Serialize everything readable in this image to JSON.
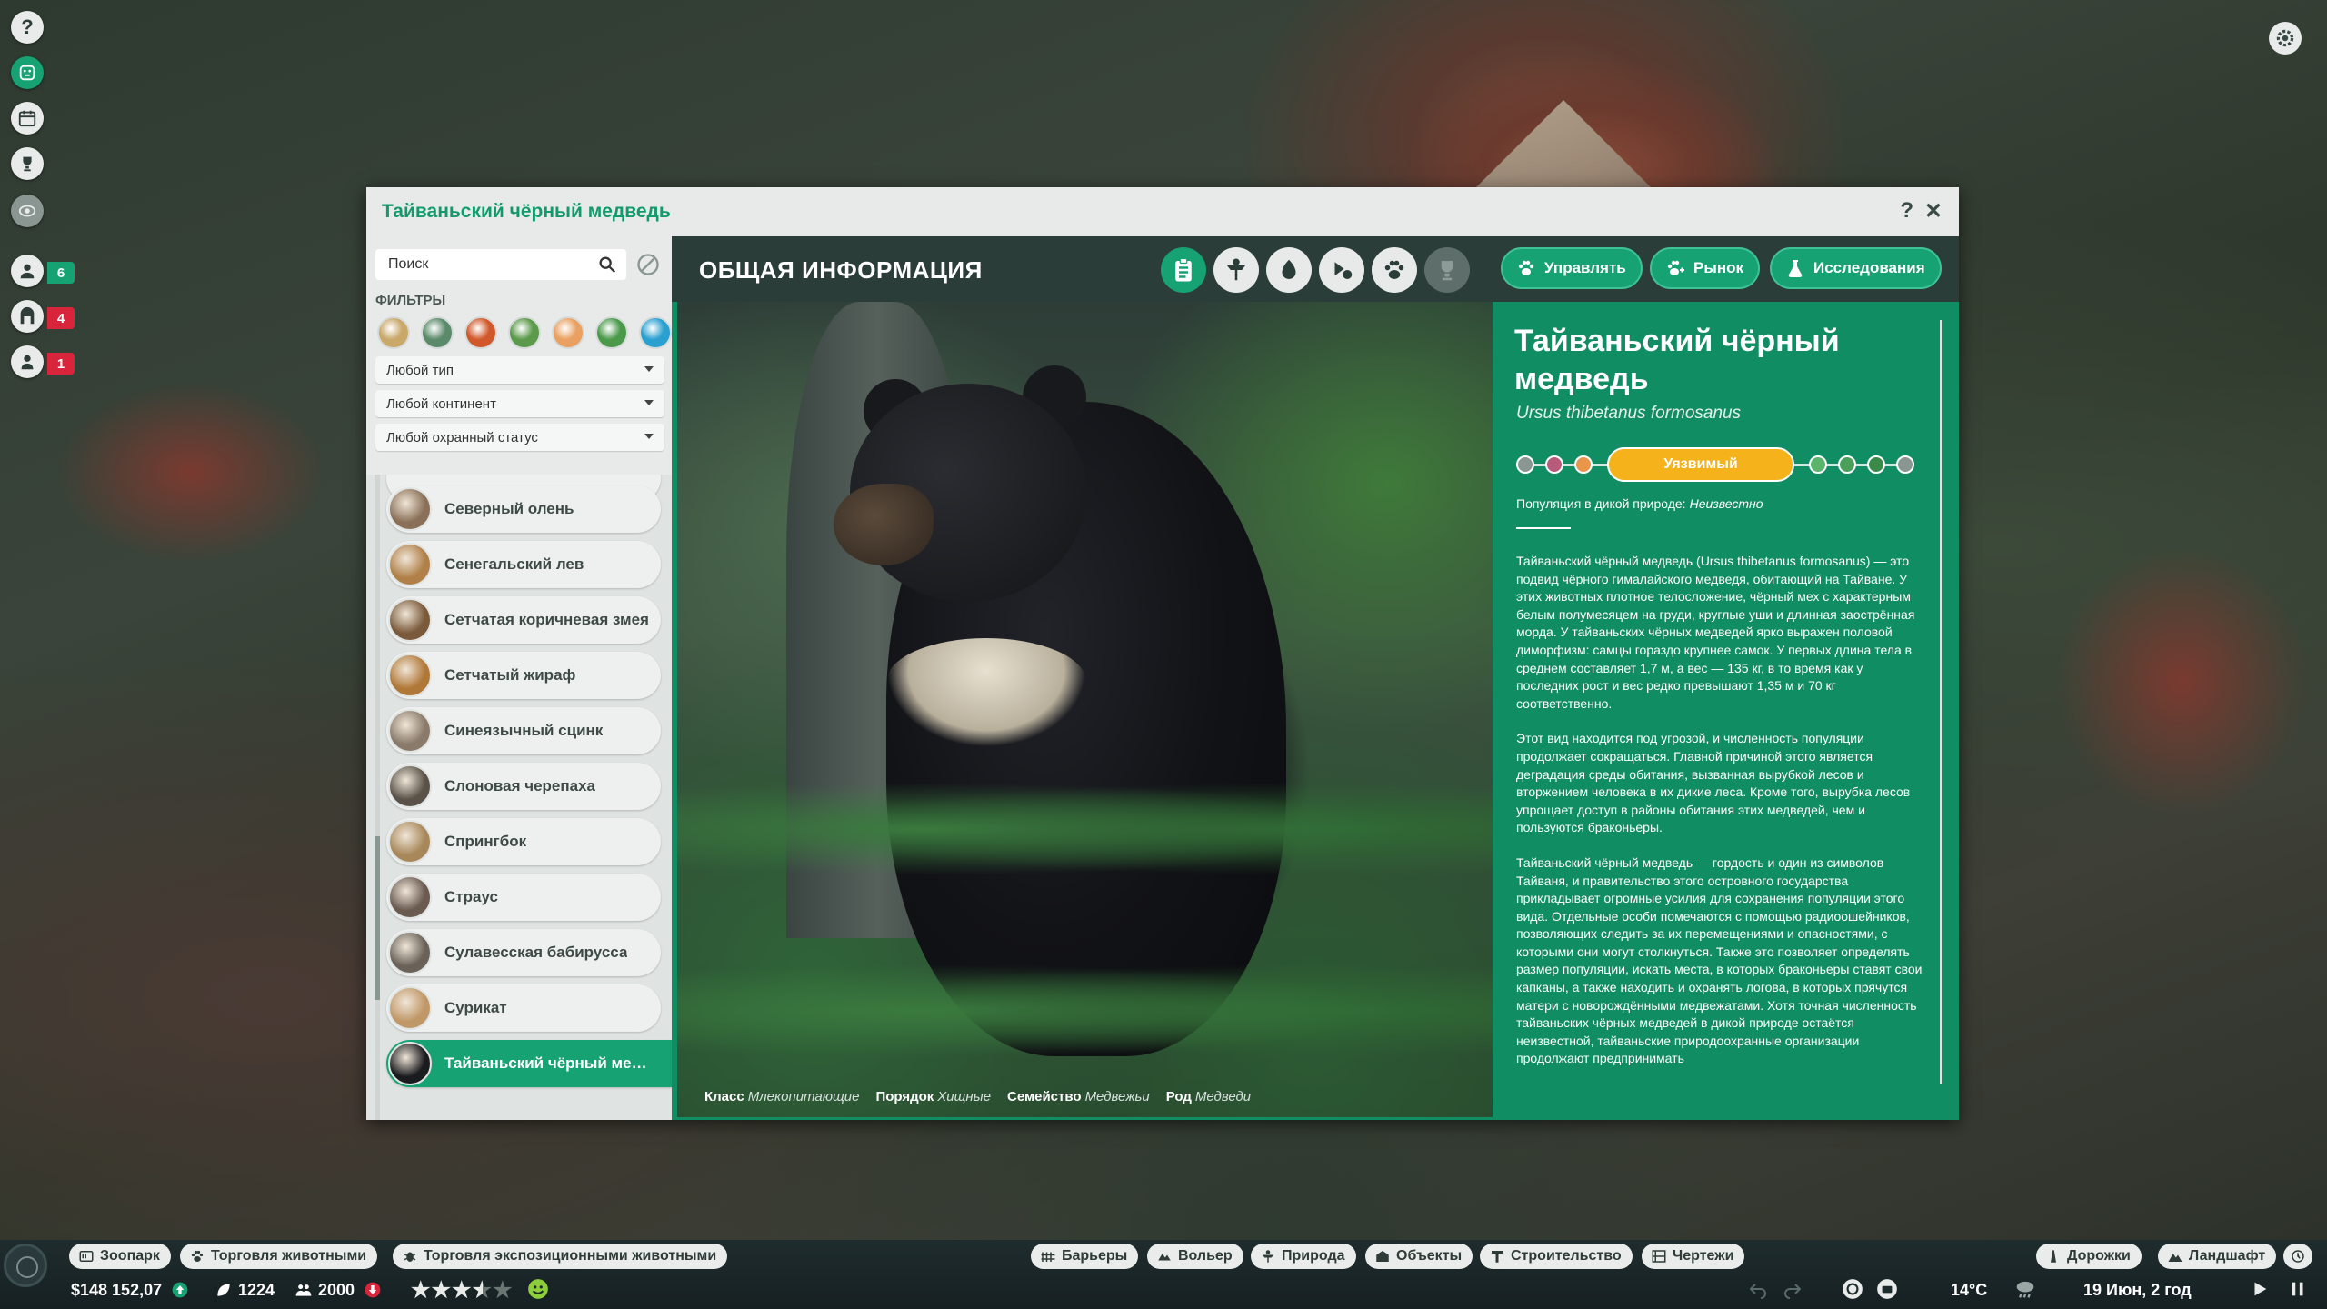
{
  "window": {
    "title": "Тайваньский чёрный медведь",
    "help": "?",
    "close": "✕"
  },
  "left_icons": [
    {
      "name": "help-icon"
    },
    {
      "name": "animal-icon"
    },
    {
      "name": "calendar-icon"
    },
    {
      "name": "trophy-icon"
    },
    {
      "name": "eye-icon"
    }
  ],
  "left_badges": [
    {
      "icon": "keeper-icon",
      "count": "6",
      "color": "#17a274"
    },
    {
      "icon": "gate-icon",
      "count": "4",
      "color": "#d9253b"
    },
    {
      "icon": "staff-icon",
      "count": "1",
      "color": "#d9253b"
    }
  ],
  "search": {
    "placeholder": "Поиск"
  },
  "filters": {
    "label": "ФИЛЬТРЫ",
    "type": "Любой тип",
    "continent": "Любой континент",
    "status": "Любой охранный статус",
    "circle_colors": [
      "#c9a86a",
      "#5a8a6a",
      "#d0582a",
      "#5a9a4a",
      "#e9a060",
      "#4a9a4a",
      "#2aa0d0"
    ]
  },
  "animals": [
    {
      "name": "Северный олень",
      "color": "#8a7058"
    },
    {
      "name": "Сенегальский лев",
      "color": "#b08048"
    },
    {
      "name": "Сетчатая коричневая змея",
      "color": "#7a5a3a"
    },
    {
      "name": "Сетчатый жираф",
      "color": "#b07838"
    },
    {
      "name": "Синеязычный сцинк",
      "color": "#8a7a6a"
    },
    {
      "name": "Слоновая черепаха",
      "color": "#5a5248"
    },
    {
      "name": "Спрингбок",
      "color": "#a8885a"
    },
    {
      "name": "Страус",
      "color": "#6a5a50"
    },
    {
      "name": "Сулавесская бабирусса",
      "color": "#6a6258"
    },
    {
      "name": "Сурикат",
      "color": "#c09868"
    },
    {
      "name": "Тайваньский чёрный мед...",
      "color": "#1a1b1f"
    }
  ],
  "main": {
    "section_title": "ОБЩАЯ ИНФОРМАЦИЯ",
    "buttons": {
      "manage": "Управлять",
      "market": "Рынок",
      "research": "Исследования"
    }
  },
  "taxonomy": {
    "class_label": "Класс",
    "class_value": "Млекопитающие",
    "order_label": "Порядок",
    "order_value": "Хищные",
    "family_label": "Семейство",
    "family_value": "Медвежьи",
    "genus_label": "Род",
    "genus_value": "Медведи"
  },
  "species": {
    "name": "Тайваньский чёрный медведь",
    "latin": "Ursus thibetanus formosanus",
    "status": "Уязвимый",
    "status_color": "#f5b21b",
    "population_label": "Популяция в дикой природе:",
    "population_value": "Неизвестно",
    "desc1": "Тайваньский чёрный медведь (Ursus thibetanus formosanus) — это подвид чёрного гималайского медведя, обитающий на Тайване. У этих животных плотное телосложение, чёрный мех с характерным белым полумесяцем на груди, круглые уши и длинная заострённая морда. У тайваньских чёрных медведей ярко выражен половой диморфизм: самцы гораздо крупнее самок. У первых длина тела в среднем составляет 1,7 м, а вес — 135 кг, в то время как у последних рост и вес редко превышают 1,35 м и 70 кг соответственно.",
    "desc2": "Этот вид находится под угрозой, и численность популяции продолжает сокращаться. Главной причиной этого является деградация среды обитания, вызванная вырубкой лесов и вторжением человека в их дикие леса. Кроме того, вырубка лесов упрощает доступ в районы обитания этих медведей, чем и пользуются браконьеры.",
    "desc3": "Тайваньский чёрный медведь — гордость и один из символов Тайваня, и правительство этого островного государства прикладывает огромные усилия для сохранения популяции этого вида. Отдельные особи помечаются с помощью радиоошейников, позволяющих следить за их перемещениями и опасностями, с которыми они могут столкнуться. Также это позволяет определять размер популяции, искать места, в которых браконьеры ставят свои капканы, а также находить и охранять логова, в которых прячутся матери с новорождёнными медвежатами. Хотя точная численность тайваньских чёрных медведей в дикой природе остаётся неизвестной, тайваньские природоохранные организации продолжают предпринимать"
  },
  "bottom_bar": {
    "left_buttons": [
      "Зоопарк",
      "Торговля животными",
      "Торговля экспозиционными животными"
    ],
    "center_buttons": [
      "Барьеры",
      "Вольер",
      "Природа",
      "Объекты",
      "Строительство",
      "Чертежи"
    ],
    "right_buttons": [
      "Дорожки",
      "Ландшафт"
    ],
    "money": "$148 152,07",
    "conservation": "1224",
    "guests": "2000",
    "rating_stars": 3.5,
    "temperature": "14°C",
    "date": "19 Июн, 2 год"
  }
}
